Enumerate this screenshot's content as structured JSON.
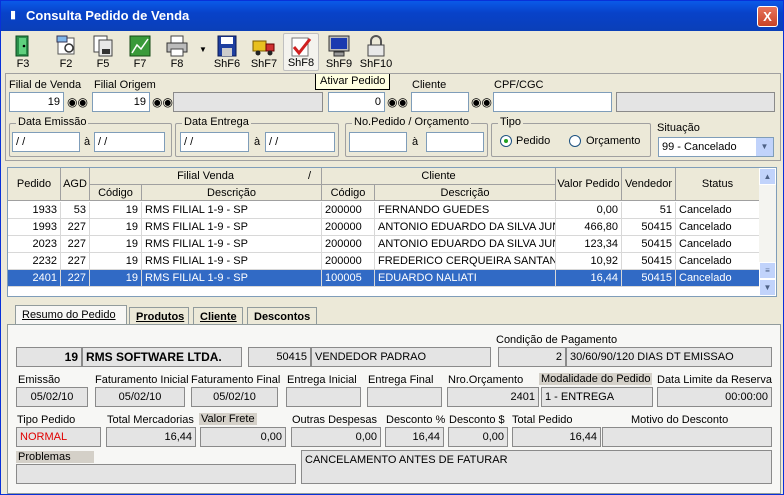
{
  "window": {
    "title": "Consulta Pedido de Venda",
    "close_label": "X"
  },
  "toolbar": {
    "buttons": [
      {
        "label": "F3"
      },
      {
        "label": "F2"
      },
      {
        "label": "F5"
      },
      {
        "label": "F7"
      },
      {
        "label": "F8"
      },
      {
        "label": "ShF6"
      },
      {
        "label": "ShF7"
      },
      {
        "label": "ShF8"
      },
      {
        "label": "ShF9"
      },
      {
        "label": "ShF10"
      }
    ],
    "tooltip": "Ativar Pedido"
  },
  "filters": {
    "filial_venda_label": "Filial de Venda",
    "filial_venda_value": "19",
    "filial_origem_label": "Filial Origem",
    "filial_origem_value": "19",
    "field_zero": "0",
    "cliente_label": "Cliente",
    "cpf_label": "CPF/CGC",
    "data_emissao_label": "Data Emissão",
    "data_entrega_label": "Data Entrega",
    "pedido_orc_label": "No.Pedido / Orçamento",
    "tipo_label": "Tipo",
    "radio_pedido": "Pedido",
    "radio_orcamento": "Orçamento",
    "situacao_label": "Situação",
    "situacao_value": "99 - Cancelado",
    "date_placeholder": "/ /",
    "a_label": "à"
  },
  "grid": {
    "headers": {
      "pedido": "Pedido",
      "agd": "AGD",
      "filial_venda": "Filial Venda",
      "sort_mark": "/",
      "cliente": "Cliente",
      "codigo": "Código",
      "descricao": "Descrição",
      "valor": "Valor Pedido",
      "vendedor": "Vendedor",
      "status": "Status"
    },
    "rows": [
      {
        "pedido": "1933",
        "agd": "53",
        "fcod": "19",
        "fdesc": "RMS FILIAL 1-9 - SP",
        "ccod": "200000",
        "cdesc": "FERNANDO GUEDES",
        "valor": "0,00",
        "vendedor": "51",
        "status": "Cancelado"
      },
      {
        "pedido": "1993",
        "agd": "227",
        "fcod": "19",
        "fdesc": "RMS FILIAL 1-9 - SP",
        "ccod": "200000",
        "cdesc": "ANTONIO EDUARDO DA SILVA JUNI",
        "valor": "466,80",
        "vendedor": "50415",
        "status": "Cancelado"
      },
      {
        "pedido": "2023",
        "agd": "227",
        "fcod": "19",
        "fdesc": "RMS FILIAL 1-9 - SP",
        "ccod": "200000",
        "cdesc": "ANTONIO EDUARDO DA SILVA JUNI",
        "valor": "123,34",
        "vendedor": "50415",
        "status": "Cancelado"
      },
      {
        "pedido": "2232",
        "agd": "227",
        "fcod": "19",
        "fdesc": "RMS FILIAL 1-9 - SP",
        "ccod": "200000",
        "cdesc": "FREDERICO CERQUEIRA SANTANA",
        "valor": "10,92",
        "vendedor": "50415",
        "status": "Cancelado"
      },
      {
        "pedido": "2401",
        "agd": "227",
        "fcod": "19",
        "fdesc": "RMS FILIAL 1-9 - SP",
        "ccod": "100005",
        "cdesc": "EDUARDO NALIATI",
        "valor": "16,44",
        "vendedor": "50415",
        "status": "Cancelado"
      }
    ]
  },
  "tabs": [
    "Resumo do Pedido",
    "Produtos",
    "Cliente",
    "Descontos"
  ],
  "resumo": {
    "condicao_label": "Condição de Pagamento",
    "filial_num": "19",
    "filial_nome": "RMS SOFTWARE LTDA.",
    "vendedor_cod": "50415",
    "vendedor_nome": "VENDEDOR PADRAO",
    "cond_cod": "2",
    "cond_desc": "30/60/90/120 DIAS DT EMISSAO",
    "emissao_label": "Emissão",
    "emissao_value": "05/02/10",
    "fat_ini_label": "Faturamento Inicial",
    "fat_ini_value": "05/02/10",
    "fat_fin_label": "Faturamento Final",
    "fat_fin_value": "05/02/10",
    "ent_ini_label": "Entrega Inicial",
    "ent_fin_label": "Entrega Final",
    "nro_orc_label": "Nro.Orçamento",
    "nro_orc_value": "2401",
    "modalidade_label": "Modalidade do Pedido",
    "modalidade_value": "1 - ENTREGA",
    "reserva_label": "Data Limite da Reserva",
    "reserva_value": "00:00:00",
    "tipo_label": "Tipo Pedido",
    "tipo_value": "NORMAL",
    "total_merc_label": "Total Mercadorias",
    "total_merc_value": "16,44",
    "frete_label": "Valor Frete",
    "frete_value": "0,00",
    "outras_label": "Outras Despesas",
    "outras_value": "0,00",
    "desc_pct_label": "Desconto %",
    "desc_pct_value": "16,44",
    "desc_val_label": "Desconto $",
    "desc_val_value": "0,00",
    "total_label": "Total Pedido",
    "total_value": "16,44",
    "motivo_label": "Motivo do Desconto",
    "problemas_label": "Problemas",
    "obs_value": "CANCELAMENTO ANTES DE FATURAR"
  },
  "colors": {
    "title_bar": "#0842c9",
    "selection": "#316ac5",
    "tipo_text": "#e00000"
  }
}
